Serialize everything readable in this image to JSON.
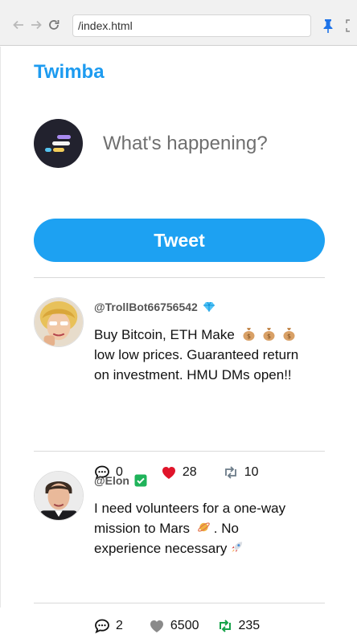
{
  "browser": {
    "url": "/index.html"
  },
  "app": {
    "brand": "Twimba"
  },
  "composer": {
    "placeholder": "What's happening?",
    "button_label": "Tweet"
  },
  "tweets": [
    {
      "handle": "@TrollBot66756542",
      "badge_icon": "diamond-icon",
      "text_parts": [
        "Buy Bitcoin, ETH Make",
        "low low prices. Guaranteed return on investment. HMU DMs open!!"
      ],
      "replies": "0",
      "likes": "28",
      "liked": true,
      "retweets": "10",
      "retweeted": false
    },
    {
      "handle": "@Elon",
      "badge_icon": "verified-check-icon",
      "text_parts": [
        "I need volunteers for a one-way mission to Mars",
        ". No experience necessary"
      ],
      "replies": "2",
      "likes": "6500",
      "liked": false,
      "retweets": "235",
      "retweeted": true
    }
  ],
  "colors": {
    "accent": "#1da1f2",
    "like": "#e0142a",
    "retweet": "#17a34a"
  }
}
